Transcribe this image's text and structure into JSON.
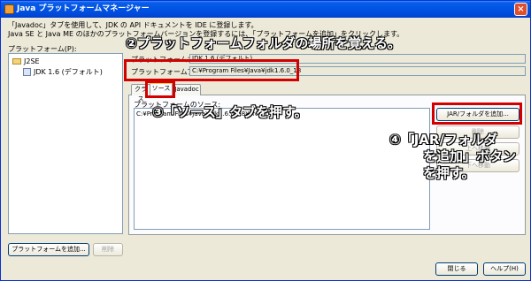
{
  "window": {
    "title": "Java プラットフォームマネージャー",
    "close_glyph": "×"
  },
  "description": {
    "line1": "「Javadoc」タブを使用して、JDK の API ドキュメントを IDE に登録します。",
    "line2": "Java SE と Java ME のほかのプラットフォームバージョンを登録するには、「プラットフォームを追加」をクリックします。"
  },
  "platforms_label": "プラットフォーム(P):",
  "tree": {
    "root": "J2SE",
    "child": "JDK 1.6 (デフォルト)"
  },
  "platform_name_label": "プラットフォーム名:",
  "platform_name_value": "JDK 1.6 (デフォルト)",
  "platform_folder_label": "プラットフォームフォルダ:",
  "platform_folder_value": "C:¥Program Files¥Java¥jdk1.6.0_18",
  "tabs": [
    {
      "label": "クラス"
    },
    {
      "label": "ソース"
    },
    {
      "label": "Javadoc"
    }
  ],
  "sources_label": "プラットフォームのソース:",
  "sources_list": [
    "C:¥Program Files¥Java¥jdk1.6.0_18¥src.zip"
  ],
  "right_buttons": {
    "add_jar": "JAR/フォルダを追加...",
    "remove": "削除",
    "up": "上へ移動",
    "down": "下へ移動"
  },
  "bottom_buttons": {
    "add_platform": "プラットフォームを追加...",
    "remove": "削除",
    "close": "閉じる",
    "help": "ヘルプ(H)"
  },
  "annotations": {
    "a2": "②プラットフォームフォルダの場所を覚える。",
    "a3": "③「ソース」タブを押す。",
    "a4_line1": "④「JAR/フォルダ",
    "a4_line2": "を追加」ボタン",
    "a4_line3": "を押す。"
  },
  "colors": {
    "accent_red": "#d30000",
    "titlebar_blue": "#0054e3"
  }
}
